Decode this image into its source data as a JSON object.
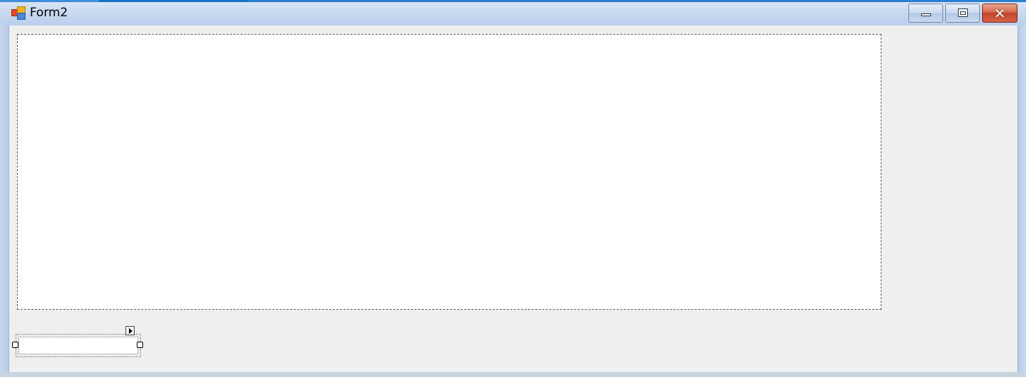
{
  "window": {
    "title": "Form2",
    "icon": "windows-form-icon",
    "controls": {
      "minimize_icon": "minimize-icon",
      "maximize_icon": "maximize-icon",
      "close_icon": "close-icon",
      "close_glyph": "✕"
    }
  },
  "designer": {
    "panel": {
      "selected": false
    },
    "textbox": {
      "value": "",
      "selected": true,
      "smart_tag_icon": "smart-tag-arrow-icon"
    }
  },
  "colors": {
    "titlebar": "#c6d8ef",
    "client_background": "#efefef",
    "close_button": "#c24429"
  }
}
